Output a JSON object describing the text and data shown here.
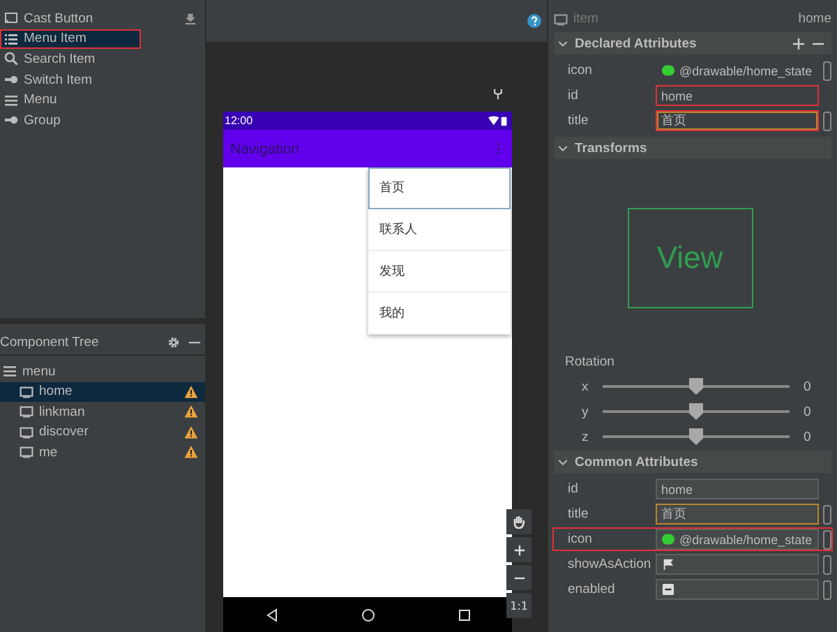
{
  "palette": {
    "items": [
      {
        "label": "Cast Button",
        "kind": "cast",
        "selected": false,
        "highlighted": false,
        "download": true
      },
      {
        "label": "Menu Item",
        "kind": "list",
        "selected": true,
        "highlighted": true,
        "download": false
      },
      {
        "label": "Search Item",
        "kind": "search",
        "selected": false,
        "highlighted": false,
        "download": false
      },
      {
        "label": "Switch Item",
        "kind": "switch",
        "selected": false,
        "highlighted": false,
        "download": false
      },
      {
        "label": "Menu",
        "kind": "menu",
        "selected": false,
        "highlighted": false,
        "download": false
      },
      {
        "label": "Group",
        "kind": "group",
        "selected": false,
        "highlighted": false,
        "download": false
      }
    ]
  },
  "component_tree": {
    "title": "Component Tree",
    "root": {
      "label": "menu",
      "children": [
        {
          "label": "home",
          "selected": true,
          "warning": true
        },
        {
          "label": "linkman",
          "selected": false,
          "warning": true
        },
        {
          "label": "discover",
          "selected": false,
          "warning": true
        },
        {
          "label": "me",
          "selected": false,
          "warning": true
        }
      ]
    }
  },
  "preview": {
    "status_time": "12:00",
    "app_title": "Navigation",
    "menu_items": [
      {
        "label": "首页",
        "selected": true
      },
      {
        "label": "联系人",
        "selected": false
      },
      {
        "label": "发现",
        "selected": false
      },
      {
        "label": "我的",
        "selected": false
      }
    ],
    "zoom_label": "1:1"
  },
  "attributes": {
    "component": "item",
    "id": "home",
    "declared": {
      "title": "Declared Attributes",
      "rows": [
        {
          "name": "icon",
          "kind": "drawable",
          "value": "@drawable/home_state",
          "highlighted": false,
          "focused": false,
          "picker": true
        },
        {
          "name": "id",
          "kind": "text",
          "value": "home",
          "highlighted": true,
          "focused": false,
          "picker": false
        },
        {
          "name": "title",
          "kind": "text",
          "value": "首页",
          "highlighted": true,
          "focused": true,
          "picker": true
        }
      ]
    },
    "transforms": {
      "title": "Transforms",
      "preview_text": "View",
      "rotation_label": "Rotation",
      "sliders": [
        {
          "axis": "x",
          "level": 0.5,
          "reading": "0"
        },
        {
          "axis": "y",
          "level": 0.5,
          "reading": "0"
        },
        {
          "axis": "z",
          "level": 0.5,
          "reading": "0"
        }
      ]
    },
    "common": {
      "title": "Common Attributes",
      "rows": [
        {
          "name": "id",
          "kind": "text",
          "value": "home",
          "highlighted": false,
          "focused": false,
          "picker": false
        },
        {
          "name": "title",
          "kind": "text",
          "value": "首页",
          "highlighted": false,
          "focused": true,
          "picker": true
        },
        {
          "name": "icon",
          "kind": "drawable",
          "value": "@drawable/home_state",
          "highlighted": true,
          "focused": false,
          "picker": true
        },
        {
          "name": "showAsAction",
          "kind": "flag",
          "highlighted": false,
          "focused": false,
          "picker": true
        },
        {
          "name": "enabled",
          "kind": "tristate",
          "highlighted": false,
          "focused": false,
          "picker": true
        }
      ]
    }
  }
}
